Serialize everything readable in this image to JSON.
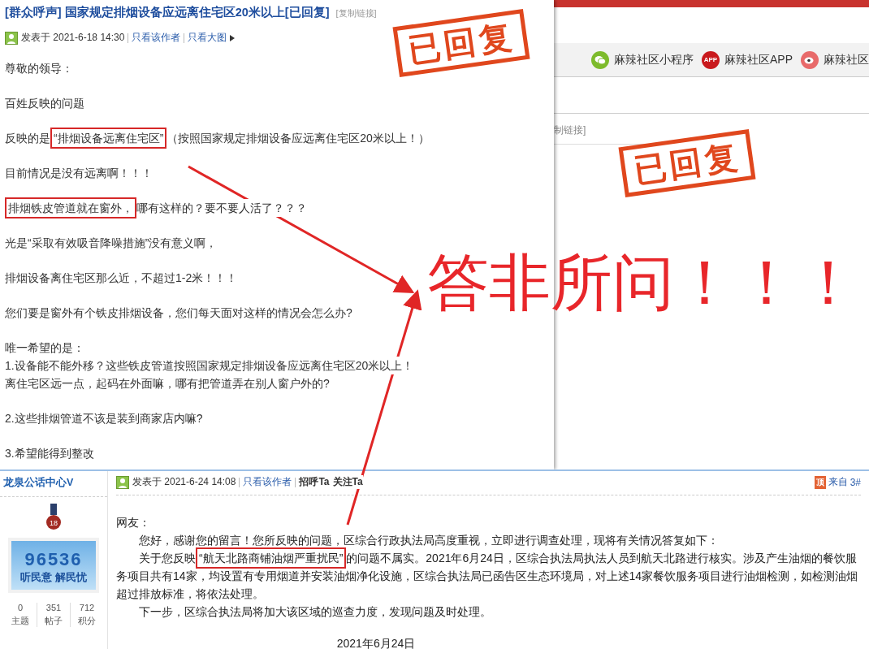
{
  "background_window": {
    "apps": [
      {
        "kind": "wechat",
        "label": "麻辣社区小程序"
      },
      {
        "kind": "app",
        "icon_text": "APP",
        "label": "麻辣社区APP"
      },
      {
        "kind": "weibo",
        "label": "麻辣社区"
      }
    ],
    "link_fragment": "制链接]",
    "stamp": "已回复"
  },
  "post": {
    "title": "[群众呼声] 国家规定排烟设备应远离住宅区20米以上[已回复]",
    "copy_link": "[复制链接]",
    "posted": "发表于 2021-6-18 14:30",
    "links": [
      "只看该作者",
      "只看大图"
    ],
    "stamp": "已回复",
    "groups": [
      [
        {
          "parts": [
            {
              "text": "尊敬的领导：",
              "boxed": false
            }
          ]
        }
      ],
      [
        {
          "parts": [
            {
              "text": "百姓反映的问题",
              "boxed": false
            }
          ]
        }
      ],
      [
        {
          "parts": [
            {
              "text": "反映的是",
              "boxed": false
            },
            {
              "text": "“排烟设备远离住宅区”",
              "boxed": true
            },
            {
              "text": "（按照国家规定排烟设备应远离住宅区20米以上！）",
              "boxed": false
            }
          ]
        }
      ],
      [
        {
          "parts": [
            {
              "text": "目前情况是没有远离啊！！！",
              "boxed": false
            }
          ]
        }
      ],
      [
        {
          "parts": [
            {
              "text": "排烟铁皮管道就在窗外，",
              "boxed": true
            },
            {
              "text": "哪有这样的？要不要人活了？？？",
              "boxed": false
            }
          ]
        }
      ],
      [
        {
          "parts": [
            {
              "text": "光是“采取有效吸音降噪措施”没有意义啊，",
              "boxed": false
            }
          ]
        }
      ],
      [
        {
          "parts": [
            {
              "text": "排烟设备离住宅区那么近，不超过1-2米！！！",
              "boxed": false
            }
          ]
        }
      ],
      [
        {
          "parts": [
            {
              "text": "您们要是窗外有个铁皮排烟设备，您们每天面对这样的情况会怎么办?",
              "boxed": false
            }
          ]
        }
      ],
      [
        {
          "parts": [
            {
              "text": "唯一希望的是：",
              "boxed": false
            }
          ]
        },
        {
          "parts": [
            {
              "text": "1.设备能不能外移？这些铁皮管道按照国家规定排烟设备应远离住宅区20米以上！",
              "boxed": false
            }
          ]
        },
        {
          "parts": [
            {
              "text": "离住宅区远一点，起码在外面嘛，哪有把管道弄在别人窗户外的?",
              "boxed": false
            }
          ]
        }
      ],
      [
        {
          "parts": [
            {
              "text": "2.这些排烟管道不该是装到商家店内嘛?",
              "boxed": false
            }
          ]
        }
      ],
      [
        {
          "parts": [
            {
              "text": "3.希望能得到整改",
              "boxed": false
            }
          ]
        }
      ]
    ]
  },
  "reply": {
    "author": "龙泉公话中心V",
    "medal": "18",
    "avatar": {
      "number": "96536",
      "slogan": "听民意 解民忧"
    },
    "stats": [
      {
        "value": "0",
        "label": "主题"
      },
      {
        "value": "351",
        "label": "帖子"
      },
      {
        "value": "712",
        "label": "积分"
      }
    ],
    "posted": "发表于 2021-6-24 14:08",
    "links": [
      "只看该作者"
    ],
    "actions": [
      "招呼Ta",
      "关注Ta"
    ],
    "badge": "顶",
    "source": "来自",
    "floor": "3#",
    "greeting": "网友：",
    "paragraphs": [
      {
        "parts": [
          {
            "text": "您好，感谢您的留言！您所反映的问题，区综合行政执法局高度重视，立即进行调查处理，现将有关情况答复如下：",
            "boxed": false
          }
        ]
      },
      {
        "parts": [
          {
            "text": "关于您反映",
            "boxed": false
          },
          {
            "text": "“航天北路商铺油烟严重扰民”",
            "boxed": true
          },
          {
            "text": "的问题不属实。2021年6月24日，区综合执法局执法人员到航天北路进行核实。涉及产生油烟的餐饮服务项目共有14家，均设置有专用烟道并安装油烟净化设施，区综合执法局已函告区生态环境局，对上述14家餐饮服务项目进行油烟检测，如检测油烟超过排放标准，将依法处理。",
            "boxed": false
          }
        ]
      },
      {
        "parts": [
          {
            "text": "下一步，区综合执法局将加大该区域的巡查力度，发现问题及时处理。",
            "boxed": false
          }
        ]
      }
    ],
    "date": "2021年6月24日"
  },
  "annotation": {
    "text": "答非所问！！！"
  }
}
